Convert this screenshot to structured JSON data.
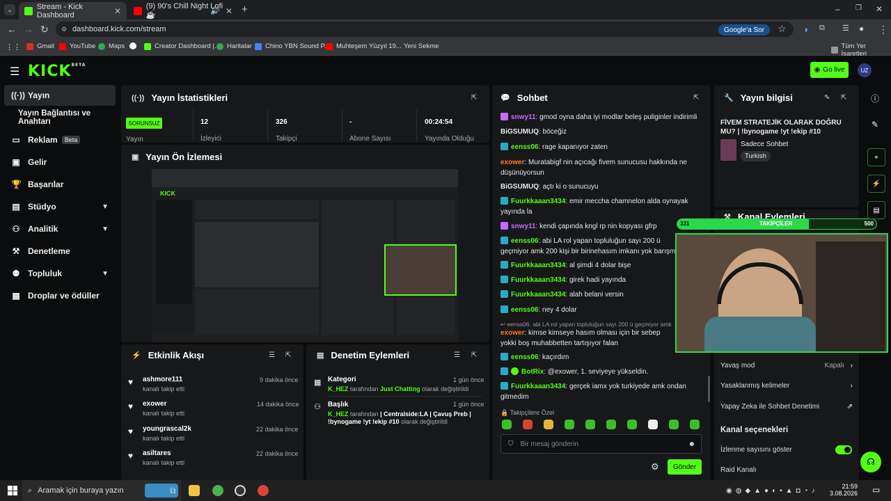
{
  "browser": {
    "tabs": [
      {
        "title": "Stream - Kick Dashboard",
        "active": true
      },
      {
        "title": "(9) 90's Chill Night Lofi ☕",
        "active": false
      }
    ],
    "url": "dashboard.kick.com/stream",
    "google_button": "Google'a Sor",
    "bookmarks": [
      "Gmail",
      "YouTube",
      "Maps",
      "Creator Dashboard |...",
      "Haritalar",
      "Chino YBN Sound P...",
      "Muhteşem Yüzyıl 19...",
      "Yeni Sekme"
    ],
    "all_bookmarks": "Tüm Yer İşaretleri"
  },
  "app": {
    "logo": "KICK",
    "logo_sup": "BETA",
    "go_live": "Go live",
    "avatar": "UZ",
    "accent": "#53fc18"
  },
  "sidebar": {
    "items": [
      {
        "label": "Yayın",
        "icon": "broadcast-icon",
        "active": true
      },
      {
        "label": "Yayın Bağlantısı ve Anahtarı",
        "icon": ""
      },
      {
        "label": "Reklam",
        "icon": "ad-icon",
        "badge": "Beta"
      },
      {
        "label": "Gelir",
        "icon": "revenue-icon"
      },
      {
        "label": "Başarılar",
        "icon": "trophy-icon"
      },
      {
        "label": "Stüdyo",
        "icon": "studio-icon"
      },
      {
        "label": "Analitik",
        "icon": "analytics-icon"
      },
      {
        "label": "Denetleme",
        "icon": "moderation-icon"
      },
      {
        "label": "Topluluk",
        "icon": "community-icon"
      },
      {
        "label": "Droplar ve ödüller",
        "icon": "drops-icon"
      }
    ]
  },
  "stats": {
    "title": "Yayın İstatistikleri",
    "status": "SORUNSUZ",
    "status_label": "Yayın",
    "viewers": {
      "value": "12",
      "label": "İzleyici"
    },
    "followers": {
      "value": "326",
      "label": "Takipçi"
    },
    "subs": {
      "value": "-",
      "label": "Abone Sayısı"
    },
    "uptime": {
      "value": "00:24:54",
      "label": "Yayında Olduğu"
    }
  },
  "preview": {
    "title": "Yayın Ön İzlemesi"
  },
  "activity": {
    "title": "Etkinlik Akışı",
    "items": [
      {
        "name": "ashmore111",
        "sub": "kanalı takip etti",
        "time": "9 dakika önce"
      },
      {
        "name": "exower",
        "sub": "kanalı takip etti",
        "time": "14 dakika önce"
      },
      {
        "name": "youngrascal2k",
        "sub": "kanalı takip etti",
        "time": "22 dakika önce"
      },
      {
        "name": "asiltares",
        "sub": "kanalı takip etti",
        "time": "22 dakika önce"
      }
    ]
  },
  "modlog": {
    "title": "Denetim Eylemleri",
    "items": [
      {
        "title": "Kategori",
        "user": "K_HEZ",
        "mid": " tarafından ",
        "value": "Just Chatting",
        "tail": " olarak değiştirildi",
        "time": "1 gün önce"
      },
      {
        "title": "Başlık",
        "user": "K_HEZ",
        "mid": " tarafından ",
        "value": "| Centralside:LA | Çavuş Preb | !bynogame !yt !ekip #10",
        "tail": " olarak değiştirildi",
        "time": "1 gün önce"
      }
    ]
  },
  "chat": {
    "title": "Sohbet",
    "messages": [
      {
        "user": "snwy11",
        "color": "#c86bff",
        "text": "gmod oyna daha iyi modlar beleş puliginler indirimli"
      },
      {
        "user": "BiGSUMUQ",
        "color": "#ffffff",
        "text": "böceğiz"
      },
      {
        "user": "eenss06",
        "color": "#53fc18",
        "text": "rage kapanıyor zaten"
      },
      {
        "user": "exower",
        "color": "#ff7a1a",
        "text": "Muratabigf nin açıcağı fivem sunucusu hakkında ne düşünüyorsun"
      },
      {
        "user": "BiGSUMUQ",
        "color": "#ffffff",
        "text": "açtı ki o sunucuyu"
      },
      {
        "user": "Fuurkkaaan3434",
        "color": "#53fc18",
        "text": "emir meccha chamnelon alda oynayak yayında la"
      },
      {
        "user": "snwy11",
        "color": "#c86bff",
        "text": "kendi çapında kngl rp nin kopyası gfrp"
      },
      {
        "user": "eenss06",
        "color": "#53fc18",
        "text": "abi LA rol yapan topluluğun sayı 200 ü geçmiyor amk 200 kişi bir birinehasım imkanı yok barışmaz bu topluluk"
      },
      {
        "user": "Fuurkkaaan3434",
        "color": "#53fc18",
        "text": "al şimdi 4 dolar bişe"
      },
      {
        "user": "Fuurkkaaan3434",
        "color": "#53fc18",
        "text": "girek hadi yayında"
      },
      {
        "user": "Fuurkkaaan3434",
        "color": "#53fc18",
        "text": "alah belani versin"
      },
      {
        "user": "eenss06",
        "color": "#53fc18",
        "text": "ney 4 dolar"
      },
      {
        "user": "exower",
        "color": "#ff7a1a",
        "text": "kimse kimseye hasım olması için bir sebep yokki boş muhabbetten tartışıyor falan"
      },
      {
        "user": "eenss06",
        "color": "#53fc18",
        "text": "kaçırdım"
      },
      {
        "user": "BotRix",
        "color": "#53fc18",
        "text": "@exower, 1. seviyeye yükseldin."
      },
      {
        "user": "Fuurkkaaan3434",
        "color": "#53fc18",
        "text": "gerçek iamx yok turkiyede amk ondan gitmedim"
      }
    ],
    "reply_ref": "eenss06: abi LA rol yapan topluluğun sayı 200 ü geçmiyor amk",
    "emote_header": "Takipçilere Özel",
    "input_placeholder": "Bir mesaj gönderin",
    "send": "Gönder"
  },
  "stream_info": {
    "title": "Yayın bilgisi",
    "stream_title": "FİVEM STRATEJİK OLARAK DOĞRU MU? | !bynogame !yt !ekip #10",
    "category": "Sadece Sohbet",
    "tag": "Turkish"
  },
  "channel_actions": {
    "title": "Kanal Eylemleri",
    "followers_label": "TAKİPÇİLER",
    "followers_current": "331",
    "followers_goal": "500",
    "followers_progress": 0.662,
    "slow_mode": "Yavaş mod",
    "slow_mode_value": "Kapalı",
    "banned_words": "Yasaklanmış kelimeler",
    "ai_mod": "Yapay Zeka ile Sohbet Denetimi",
    "options_title": "Kanal seçenekleri",
    "show_views": "İzlenme sayısını göster",
    "raid": "Raid Kanalı"
  },
  "taskbar": {
    "search": "Aramak için buraya yazın",
    "time": "21:59",
    "date": "3.08.2026"
  }
}
